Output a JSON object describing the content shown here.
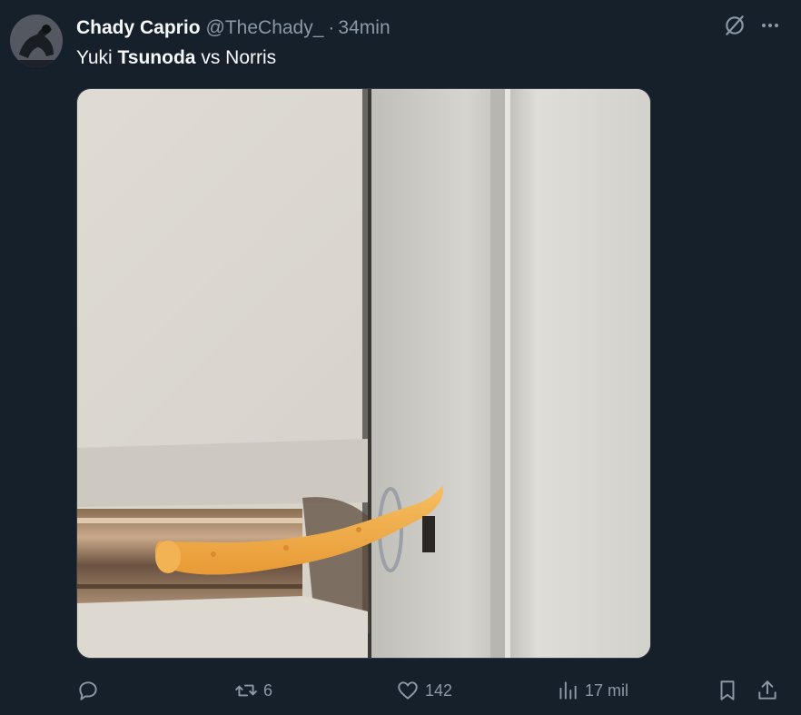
{
  "tweet": {
    "author_name": "Chady Caprio",
    "author_handle": "@TheChady_",
    "separator": "·",
    "timestamp": "34min",
    "text_part1": "Yuki ",
    "text_bold": "Tsunoda",
    "text_part2": " vs Norris"
  },
  "header_icons": [
    "grok-icon",
    "more-icon"
  ],
  "actions": {
    "reply_count": "",
    "retweet_count": "6",
    "like_count": "142",
    "views_count": "17 mil"
  },
  "colors": {
    "background": "#15202b",
    "primary_text": "#f7f9f9",
    "secondary_text": "#8b98a5"
  }
}
